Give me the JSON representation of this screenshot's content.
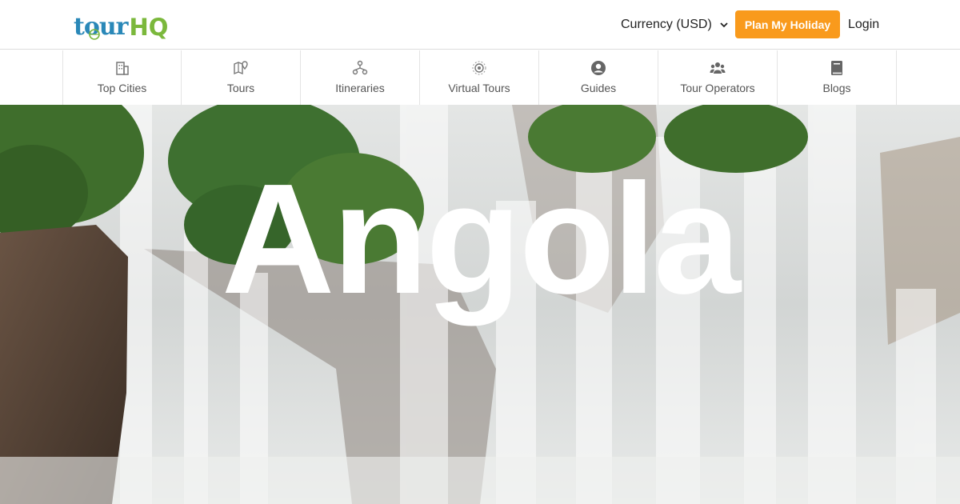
{
  "brand": {
    "logo_part1": "tour",
    "logo_part2": "HQ"
  },
  "header": {
    "currency_label": "Currency (USD)",
    "plan_button": "Plan My Holiday",
    "login": "Login"
  },
  "nav": {
    "items": [
      {
        "label": "Top Cities",
        "icon": "city-building-icon"
      },
      {
        "label": "Tours",
        "icon": "map-pin-icon"
      },
      {
        "label": "Itineraries",
        "icon": "itinerary-network-icon"
      },
      {
        "label": "Virtual Tours",
        "icon": "virtual-tour-icon"
      },
      {
        "label": "Guides",
        "icon": "user-circle-icon"
      },
      {
        "label": "Tour Operators",
        "icon": "users-group-icon"
      },
      {
        "label": "Blogs",
        "icon": "book-icon"
      }
    ]
  },
  "hero": {
    "title": "Angola"
  },
  "colors": {
    "accent": "#f99a1c",
    "logo_blue": "#2a88b8",
    "logo_green": "#7bb83c"
  }
}
